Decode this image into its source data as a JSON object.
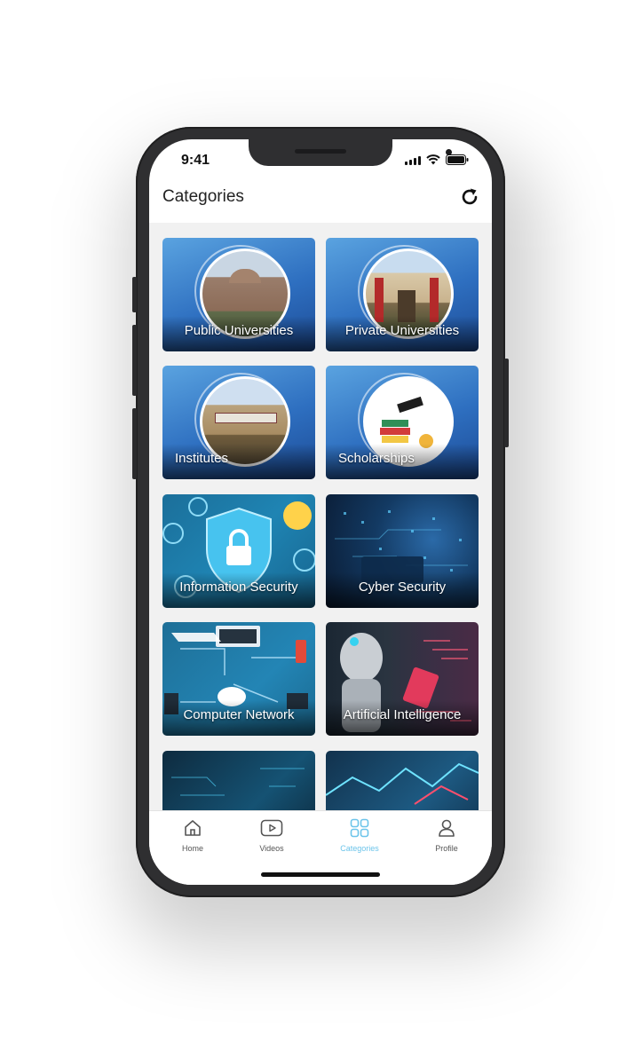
{
  "status_bar": {
    "time": "9:41"
  },
  "header": {
    "title": "Categories"
  },
  "categories": [
    {
      "label": "Public Universities"
    },
    {
      "label": "Private Universities"
    },
    {
      "label": "Institutes"
    },
    {
      "label": "Scholarships"
    },
    {
      "label": "Information Security"
    },
    {
      "label": "Cyber Security"
    },
    {
      "label": "Computer Network"
    },
    {
      "label": "Artificial Intelligence"
    }
  ],
  "tabbar": {
    "items": [
      {
        "label": "Home",
        "icon": "home-icon"
      },
      {
        "label": "Videos",
        "icon": "video-icon"
      },
      {
        "label": "Categories",
        "icon": "grid-icon"
      },
      {
        "label": "Profile",
        "icon": "user-icon"
      }
    ],
    "active": "Categories"
  },
  "colors": {
    "accent": "#6cc4ea",
    "card_blue": "#2e6fc0",
    "phone_frame": "#2f2f31"
  }
}
